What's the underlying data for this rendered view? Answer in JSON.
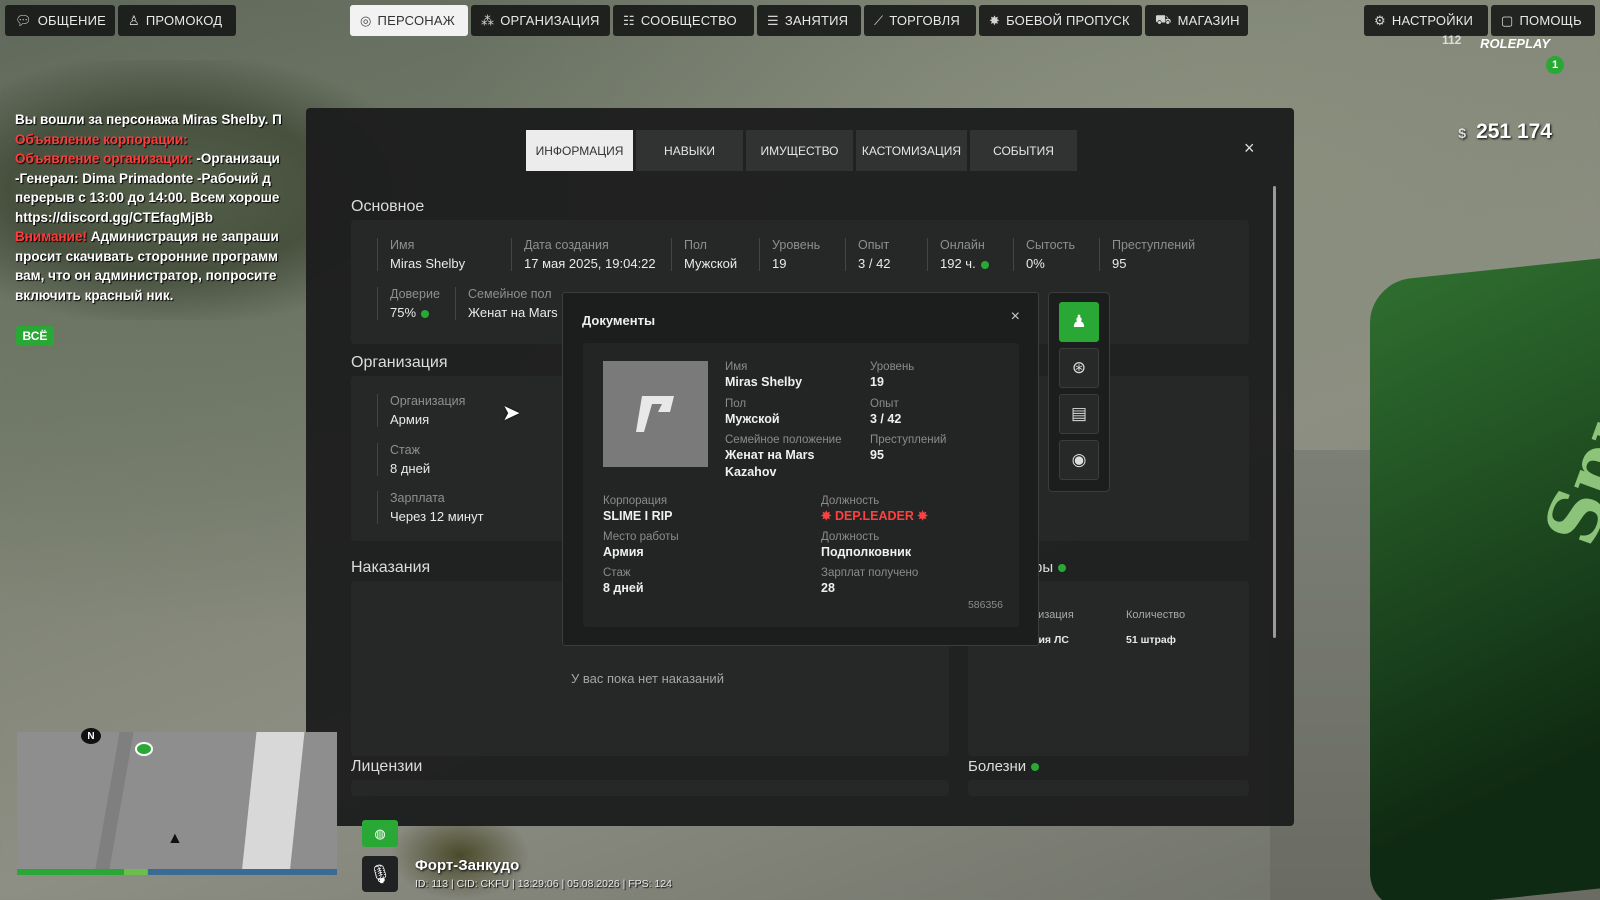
{
  "topbar": {
    "left": [
      {
        "label": "ОБЩЕНИЕ",
        "icon": "chat-icon"
      },
      {
        "label": "ПРОМОКОД",
        "icon": "person-icon"
      }
    ],
    "center": [
      {
        "label": "ПЕРСОНАЖ",
        "icon": "user-icon",
        "active": true
      },
      {
        "label": "ОРГАНИЗАЦИЯ",
        "icon": "group-icon"
      },
      {
        "label": "СООБЩЕСТВО",
        "icon": "community-icon"
      },
      {
        "label": "ЗАНЯТИЯ",
        "icon": "list-icon"
      },
      {
        "label": "ТОРГОВЛЯ",
        "icon": "chart-icon"
      },
      {
        "label": "БОЕВОЙ ПРОПУСК",
        "icon": "star-icon"
      },
      {
        "label": "МАГАЗИН",
        "icon": "cart-icon"
      }
    ],
    "right": [
      {
        "label": "НАСТРОЙКИ",
        "icon": "gear-icon"
      },
      {
        "label": "ПОМОЩЬ",
        "icon": "help-icon"
      }
    ]
  },
  "hud": {
    "money_currency": "$",
    "money_value": "251 174",
    "brand": "ROLEPLAY",
    "online": "112",
    "badge": "1"
  },
  "chat": {
    "line1": "Вы вошли за персонажа Miras Shelby. П",
    "line2_red": "Объявление корпорации:",
    "line3_red": "Объявление организации:",
    "line3_white": " -Организаци",
    "line4": "-Генерал: Dima Primadonte -Рабочий д",
    "line5": "перерыв с 13:00 до 14:00. Всем хороше",
    "line6": "https://discord.gg/CTEfagMjBb",
    "line7_red": "Внимание!",
    "line7_white": " Администрация не запраши",
    "line8": "просит скачивать сторонние программ",
    "line9": "вам, что он администратор, попросите",
    "line10": "включить красный ник.",
    "tab_all": "ВСЁ"
  },
  "panel": {
    "tabs": [
      "ИНФОРМАЦИЯ",
      "НАВЫКИ",
      "ИМУЩЕСТВО",
      "КАСТОМИЗАЦИЯ",
      "СОБЫТИЯ"
    ],
    "close": "×",
    "basic": {
      "title": "Основное",
      "name_l": "Имя",
      "name_v": "Miras Shelby",
      "created_l": "Дата создания",
      "created_v": "17 мая 2025, 19:04:22",
      "gender_l": "Пол",
      "gender_v": "Мужской",
      "level_l": "Уровень",
      "level_v": "19",
      "exp_l": "Опыт",
      "exp_v": "3 / 42",
      "online_l": "Онлайн",
      "online_v": "192 ч.",
      "satiety_l": "Сытость",
      "satiety_v": "0%",
      "crimes_l": "Преступлений",
      "crimes_v": "95",
      "trust_l": "Доверие",
      "trust_v": "75%",
      "family_l": "Семейное пол",
      "family_v": "Женат на Mars"
    },
    "org": {
      "title": "Организация",
      "org_l": "Организация",
      "org_v": "Армия",
      "exp_l": "Стаж",
      "exp_v": "8 дней",
      "salary_l": "Зарплата",
      "salary_v": "Через 12 минут"
    },
    "punish": {
      "title": "Наказания",
      "empty": "У вас пока нет наказаний"
    },
    "fines": {
      "title": "ры",
      "col1": "низация",
      "col2": "Количество",
      "val1": "ция ЛС",
      "val2": "51 штраф"
    },
    "licenses": {
      "title": "Лицензии"
    },
    "diseases": {
      "title": "Болезни"
    }
  },
  "docs": {
    "title": "Документы",
    "close": "×",
    "name_l": "Имя",
    "name_v": "Miras Shelby",
    "level_l": "Уровень",
    "level_v": "19",
    "gender_l": "Пол",
    "gender_v": "Мужской",
    "exp_l": "Опыт",
    "exp_v": "3 / 42",
    "family_l": "Семейное положение",
    "family_v1": "Женат на Mars",
    "family_v2": "Kazahov",
    "crimes_l": "Преступлений",
    "crimes_v": "95",
    "corp_l": "Корпорация",
    "corp_v": "SLIME I RIP",
    "post_l": "Должность",
    "post_v": "✸ DEP.LEADER ✸",
    "work_l": "Место работы",
    "work_v": "Армия",
    "rank_l": "Должность",
    "rank_v": "Подполковник",
    "stage_l": "Стаж",
    "stage_v": "8 дней",
    "salary_l": "Зарплат получено",
    "salary_v": "28",
    "id": "586356"
  },
  "side_icons": [
    "person-icon",
    "steering-wheel-icon",
    "document-icon",
    "gun-license-icon"
  ],
  "minimap": {
    "north": "N"
  },
  "bottom": {
    "location": "Форт-Занкудо",
    "status": "ID: 113 | CID: CKFU | 13:29:06  | 05.08.2026 | FPS: 124"
  }
}
